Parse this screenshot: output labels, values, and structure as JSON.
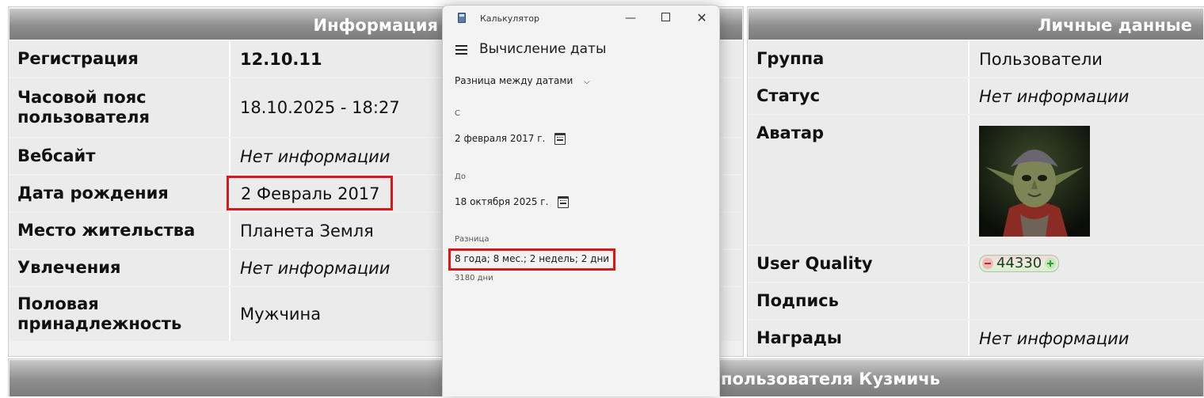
{
  "info_panel": {
    "title": "Информация",
    "rows": [
      {
        "label": "Регистрация",
        "value": "12.10.11"
      },
      {
        "label": "Часовой пояс пользователя",
        "value": "18.10.2025 - 18:27"
      },
      {
        "label": "Вебсайт",
        "value": "Нет информации"
      },
      {
        "label": "Дата рождения",
        "value": "2 Февраль 2017"
      },
      {
        "label": "Место жительства",
        "value": "Планета Земля"
      },
      {
        "label": "Увлечения",
        "value": "Нет информации"
      },
      {
        "label": "Половая принадлежность",
        "value": "Мужчина"
      }
    ]
  },
  "personal_panel": {
    "title": "Личные данные",
    "rows": [
      {
        "label": "Группа",
        "value": "Пользователи"
      },
      {
        "label": "Статус",
        "value": "Нет информации"
      },
      {
        "label": "Аватар",
        "value": ""
      },
      {
        "label": "User Quality",
        "value": "44330"
      },
      {
        "label": "Подпись",
        "value": ""
      },
      {
        "label": "Награды",
        "value": "Нет информации"
      }
    ]
  },
  "bottom_bar": {
    "title": "пользователя Кузмичь"
  },
  "calculator": {
    "app_title": "Калькулятор",
    "mode_title": "Вычисление даты",
    "mode_select": "Разница между датами",
    "from_label": "С",
    "from_date": "2 февраля 2017 г.",
    "to_label": "До",
    "to_date": "18 октября 2025 г.",
    "diff_label": "Разница",
    "diff_value": "8 года; 8 мес.; 2 недель; 2 дни",
    "diff_days": "3180 дни"
  },
  "colors": {
    "highlight_border": "#d81818",
    "header_gradient_dark": "#7c7c7c",
    "cell_background": "#ebebeb"
  }
}
